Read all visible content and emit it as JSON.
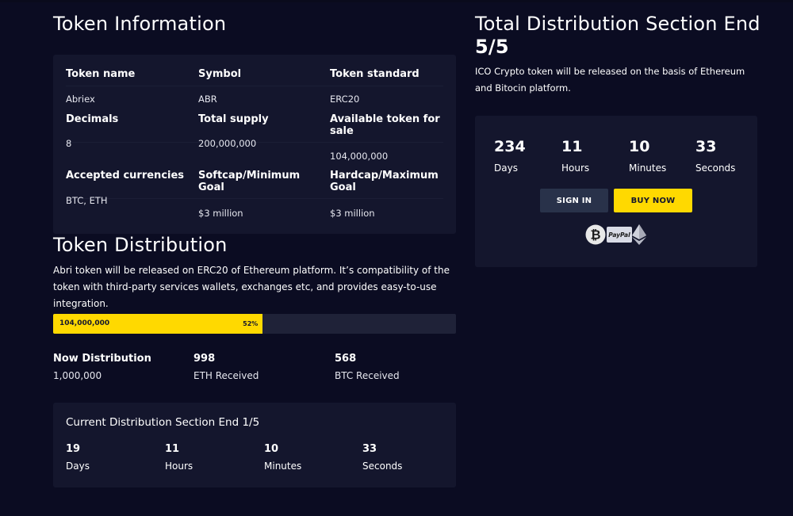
{
  "token_info": {
    "title": "Token Information",
    "fields": [
      {
        "label": "Token name",
        "value": "Abriex"
      },
      {
        "label": "Symbol",
        "value": "ABR"
      },
      {
        "label": "Token standard",
        "value": "ERC20"
      },
      {
        "label": "Decimals",
        "value": "8"
      },
      {
        "label": "Total supply",
        "value": "200,000,000"
      },
      {
        "label": "Available token for sale",
        "value": "104,000,000"
      },
      {
        "label": "Accepted currencies",
        "value": "BTC, ETH"
      },
      {
        "label": "Softcap/Minimum Goal",
        "value": "$3 million"
      },
      {
        "label": "Hardcap/Maximum Goal",
        "value": "$3 million"
      }
    ]
  },
  "distribution": {
    "title": "Token Distribution",
    "description": "Abri token will be released on ERC20 of Ethereum platform. It’s compatibility of the token with third-party services wallets, exchanges etc, and provides easy-to-use integration.",
    "progress": {
      "amount": "104,000,000",
      "percent_label": "52%",
      "fraction": 0.52
    },
    "stats": [
      {
        "value": "Now Distribution",
        "label": "1,000,000"
      },
      {
        "value": "998",
        "label": "ETH Received"
      },
      {
        "value": "568",
        "label": "BTC Received"
      }
    ],
    "current_section": {
      "title": "Current Distribution Section End 1/5",
      "countdown": [
        {
          "value": "19",
          "unit": "Days"
        },
        {
          "value": "11",
          "unit": "Hours"
        },
        {
          "value": "10",
          "unit": "Minutes"
        },
        {
          "value": "33",
          "unit": "Seconds"
        }
      ]
    }
  },
  "total": {
    "title_prefix": "Total Distribution Section End",
    "title_bold": "5/5",
    "description": "ICO Crypto token will be released on the basis of Ethereum and Bitocin platform.",
    "countdown": [
      {
        "value": "234",
        "unit": "Days"
      },
      {
        "value": "11",
        "unit": "Hours"
      },
      {
        "value": "10",
        "unit": "Minutes"
      },
      {
        "value": "33",
        "unit": "Seconds"
      }
    ],
    "signin_label": "SIGN IN",
    "buy_label": "BUY NOW",
    "payment_icons": [
      "bitcoin-icon",
      "paypal-icon",
      "ethereum-icon"
    ],
    "paypal_text": "PayPal"
  },
  "colors": {
    "background": "#0b0c22",
    "card": "#14162d",
    "accent": "#ffd900",
    "signin": "#29324a"
  }
}
